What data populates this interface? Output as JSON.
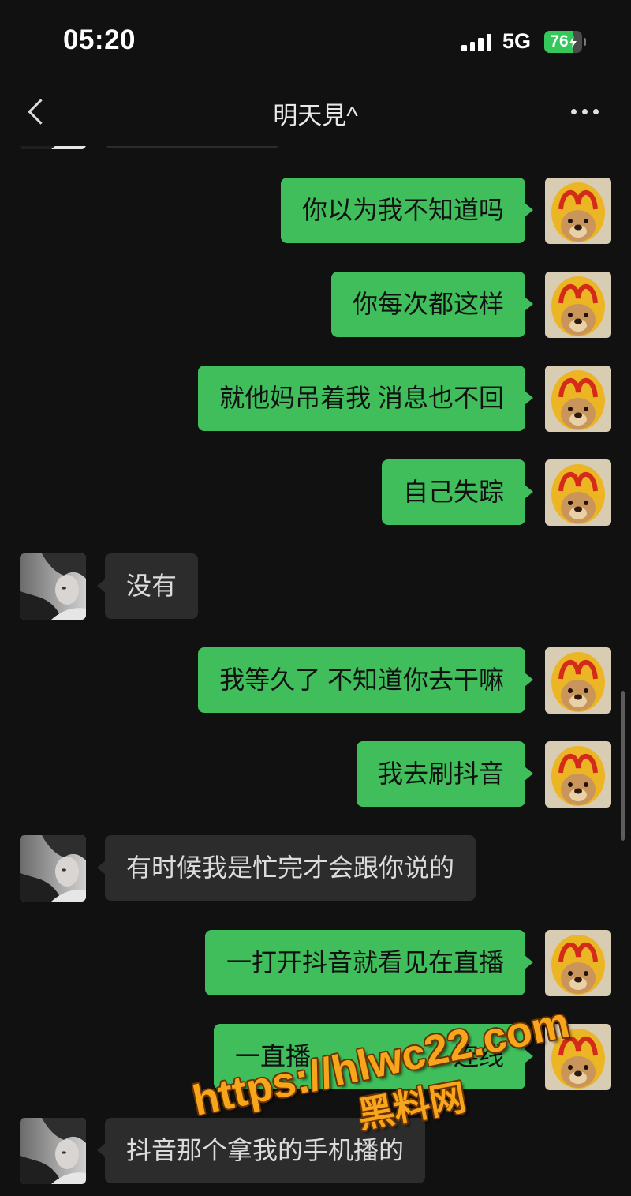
{
  "status_bar": {
    "time": "05:20",
    "network": "5G",
    "battery": "76",
    "battery_level": 0.76,
    "charging": true,
    "signal_icon": "signal-bars-icon",
    "battery_icon": "battery-charging-icon"
  },
  "header": {
    "title": "明天見^",
    "back_icon": "chevron-left-icon",
    "more_icon": "more-dots-icon"
  },
  "messages": [
    {
      "side": "sent",
      "text": "你以为我不知道吗"
    },
    {
      "side": "sent",
      "text": "你每次都这样"
    },
    {
      "side": "sent",
      "text": "就他妈吊着我 消息也不回"
    },
    {
      "side": "sent",
      "text": "自己失踪"
    },
    {
      "side": "received",
      "text": "没有"
    },
    {
      "side": "sent",
      "text": "我等久了 不知道你去干嘛"
    },
    {
      "side": "sent",
      "text": "我去刷抖音"
    },
    {
      "side": "received",
      "text": "有时候我是忙完才会跟你说的"
    },
    {
      "side": "sent",
      "text": "一打开抖音就看见在直播"
    },
    {
      "side": "sent",
      "text_parts": [
        "一直播",
        "连线"
      ]
    },
    {
      "side": "received",
      "text": "抖音那个拿我的手机播的"
    }
  ],
  "watermark": {
    "url": "https://hlwc22.com",
    "site": "黑料网"
  },
  "colors": {
    "background": "#111111",
    "sent_bubble": "#3fbe5b",
    "received_bubble": "#2c2c2c",
    "watermark": "#f7a51c"
  }
}
